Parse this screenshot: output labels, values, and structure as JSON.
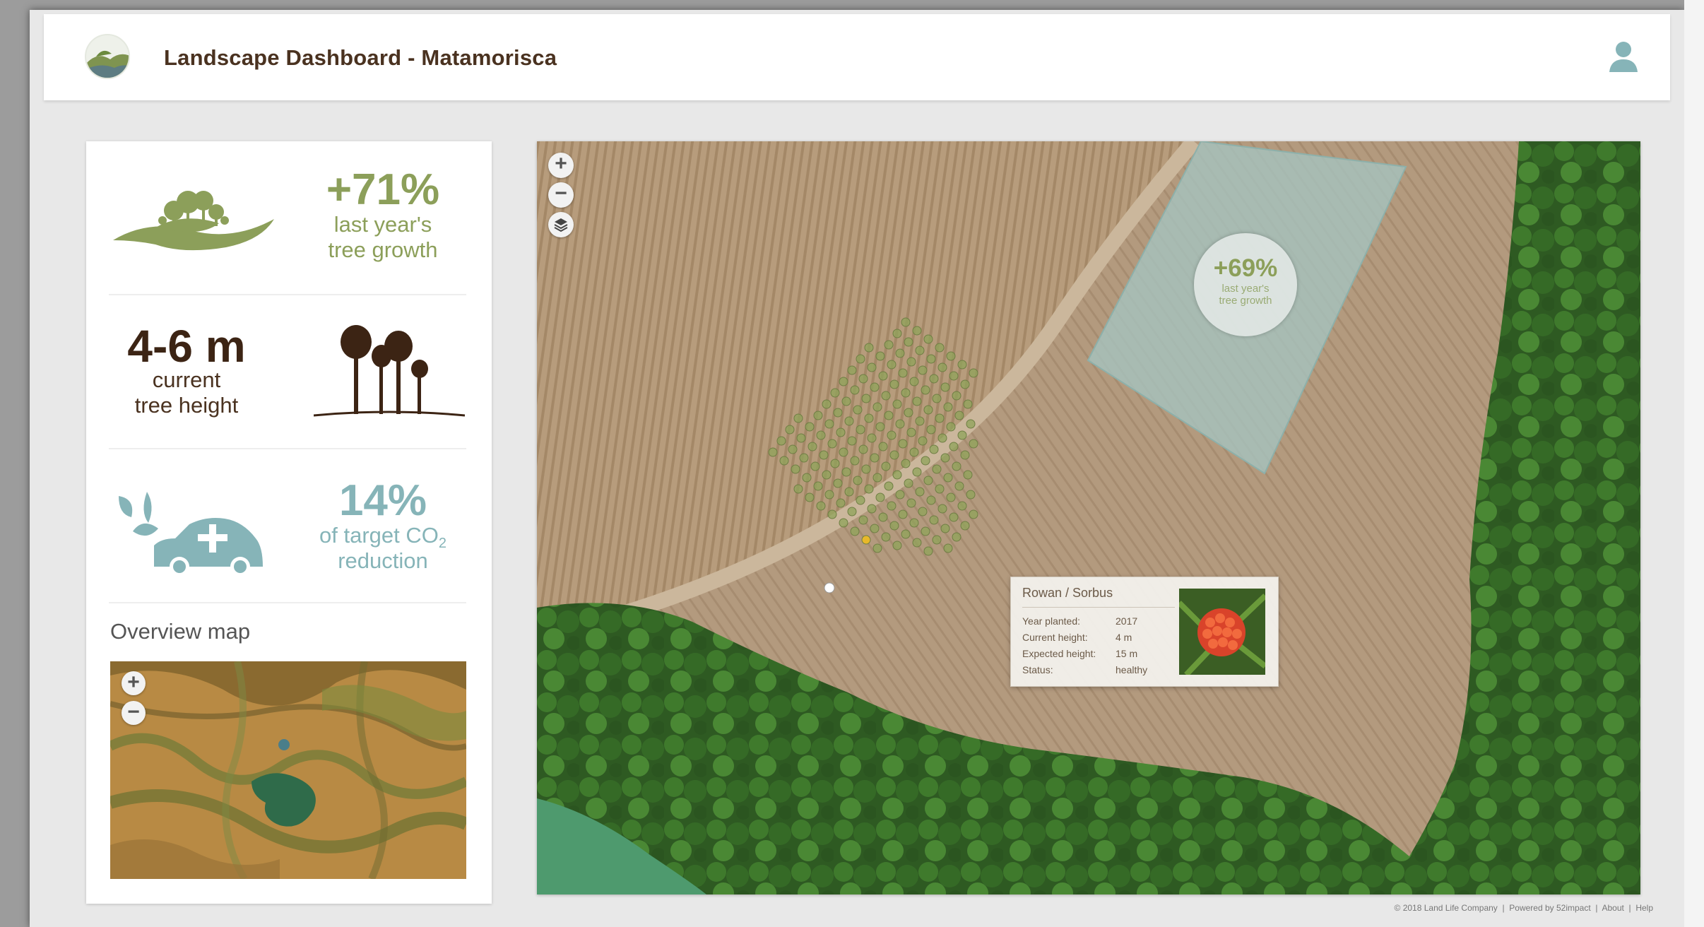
{
  "header": {
    "title": "Landscape Dashboard - Matamorisca"
  },
  "stats": {
    "growth": {
      "value": "+71%",
      "line1": "last year's",
      "line2": "tree growth"
    },
    "height": {
      "value": "4-6 m",
      "line1": "current",
      "line2": "tree height"
    },
    "co2": {
      "value": "14%",
      "line1_prefix": "of target CO",
      "line1_sub": "2",
      "line2": "reduction"
    }
  },
  "overview": {
    "title": "Overview map",
    "zoom_in": "+",
    "zoom_out": "−"
  },
  "map": {
    "zoom_in": "+",
    "zoom_out": "−",
    "area_growth": {
      "value": "+69%",
      "line1": "last year's",
      "line2": "tree growth"
    },
    "popup": {
      "title": "Rowan / Sorbus",
      "rows": [
        {
          "label": "Year planted:",
          "value": "2017"
        },
        {
          "label": "Current height:",
          "value": "4 m"
        },
        {
          "label": "Expected height:",
          "value": "15 m"
        },
        {
          "label": "Status:",
          "value": "healthy"
        }
      ]
    }
  },
  "footer": {
    "copyright": "© 2018 Land Life Company",
    "sep": "|",
    "powered": "Powered by 52impact",
    "about": "About",
    "help": "Help"
  },
  "colors": {
    "brand_brown": "#4a3220",
    "growth_green": "#8c9f5a",
    "co2_teal": "#86b4b8",
    "tree_healthy": "#8fa35a",
    "tree_warning": "#e8b82a",
    "tree_critical": "#e05a3a"
  }
}
